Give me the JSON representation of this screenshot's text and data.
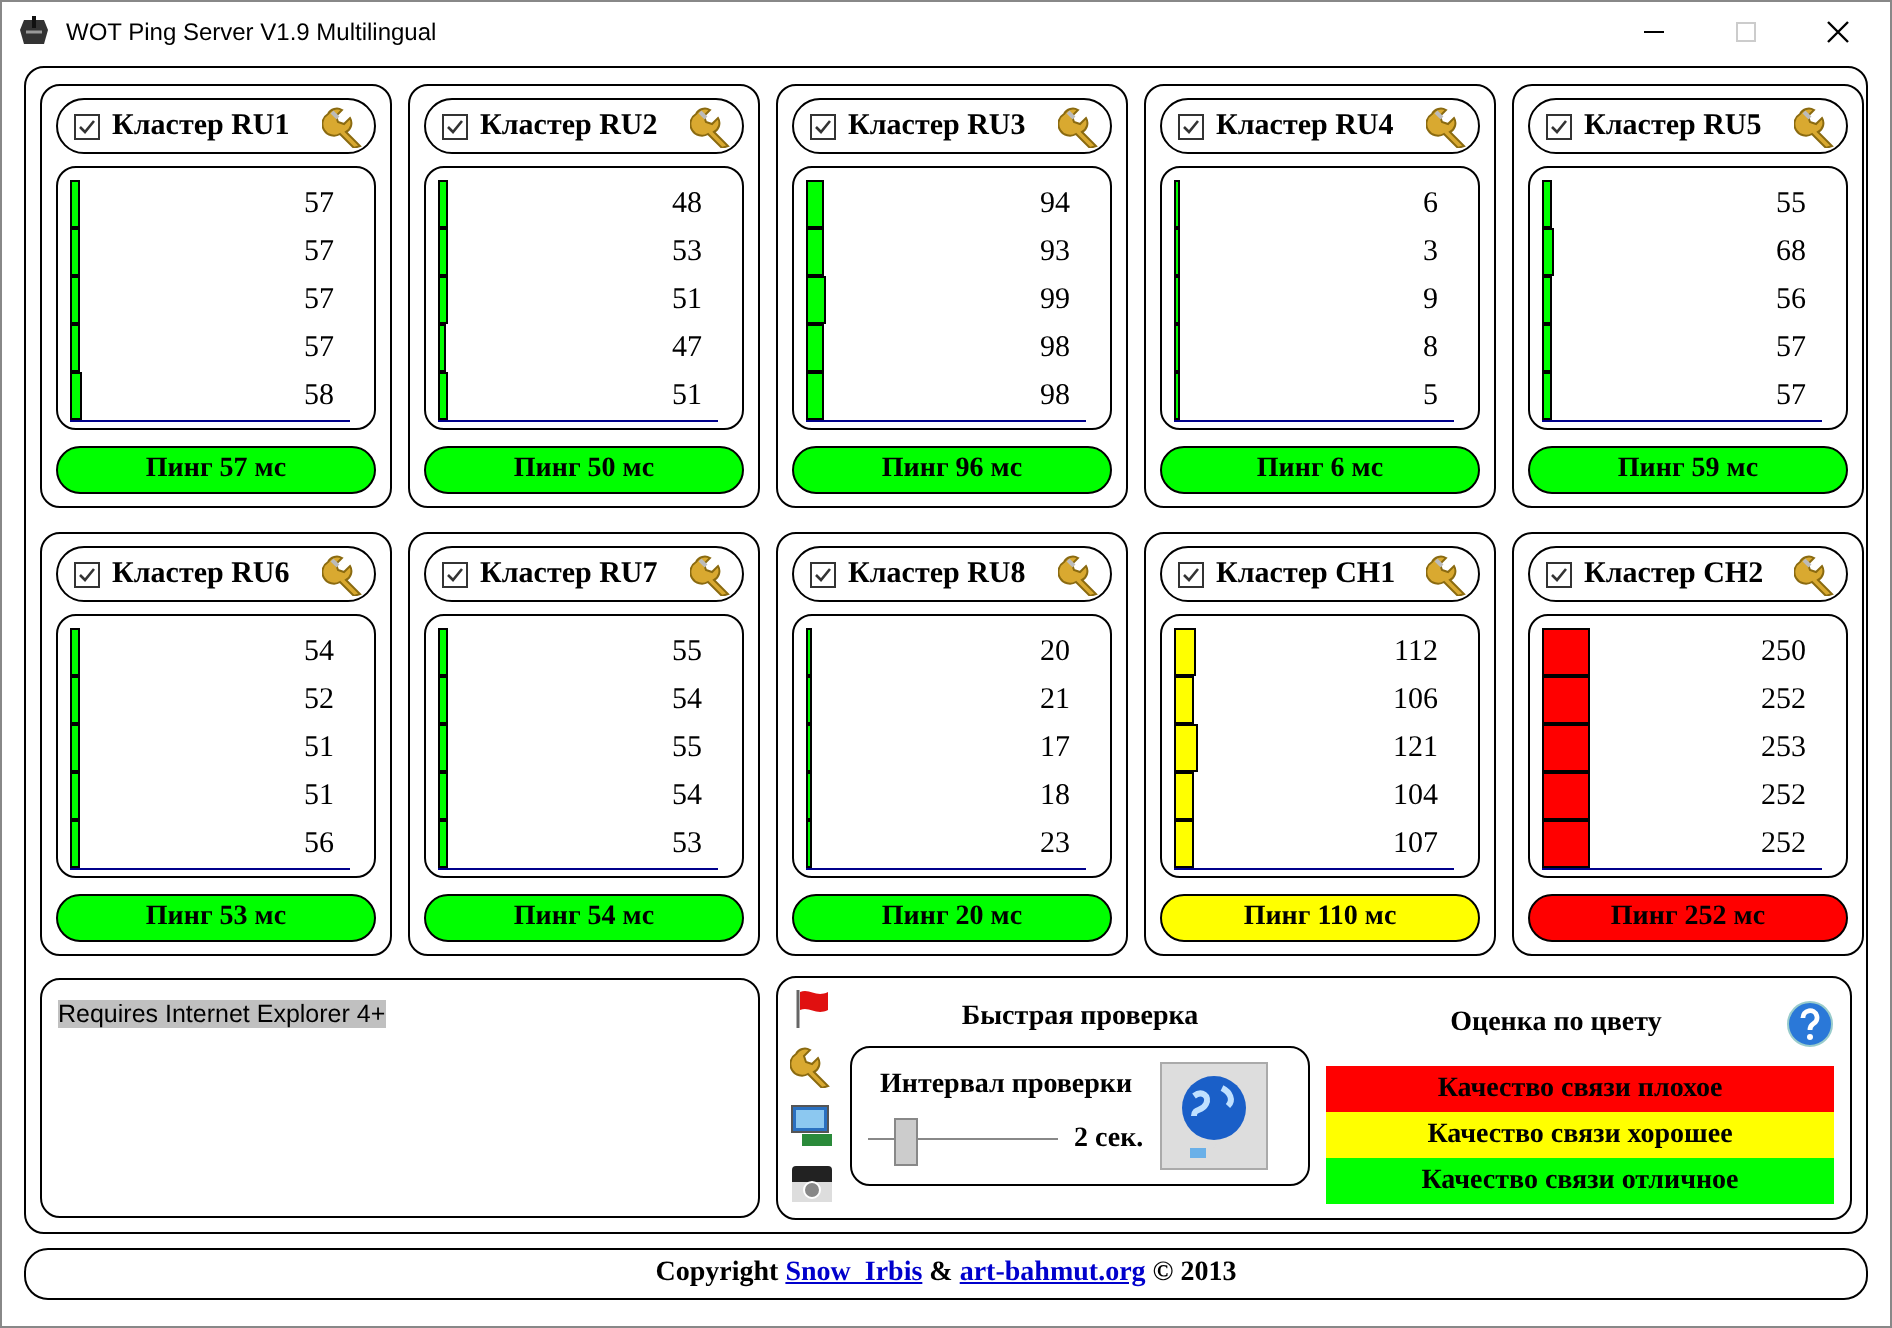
{
  "window": {
    "title": "WOT Ping Server V1.9 Multilingual"
  },
  "clusters": [
    {
      "title": "Кластер RU1",
      "checked": true,
      "color": "#00ff00",
      "ping_label": "Пинг 57 мс",
      "pings": [
        {
          "value": "57",
          "level": 0.038
        },
        {
          "value": "57",
          "level": 0.038
        },
        {
          "value": "57",
          "level": 0.038
        },
        {
          "value": "57",
          "level": 0.038
        },
        {
          "value": "58",
          "level": 0.039
        }
      ]
    },
    {
      "title": "Кластер RU2",
      "checked": true,
      "color": "#00ff00",
      "ping_label": "Пинг 50 мс",
      "pings": [
        {
          "value": "48",
          "level": 0.032
        },
        {
          "value": "53",
          "level": 0.035
        },
        {
          "value": "51",
          "level": 0.034
        },
        {
          "value": "47",
          "level": 0.031
        },
        {
          "value": "51",
          "level": 0.034
        }
      ]
    },
    {
      "title": "Кластер RU3",
      "checked": true,
      "color": "#00ff00",
      "ping_label": "Пинг 96 мс",
      "pings": [
        {
          "value": "94",
          "level": 0.063
        },
        {
          "value": "93",
          "level": 0.062
        },
        {
          "value": "99",
          "level": 0.066
        },
        {
          "value": "98",
          "level": 0.065
        },
        {
          "value": "98",
          "level": 0.065
        }
      ]
    },
    {
      "title": "Кластер RU4",
      "checked": true,
      "color": "#00ff00",
      "ping_label": "Пинг 6 мс",
      "pings": [
        {
          "value": "6",
          "level": 0.004
        },
        {
          "value": "3",
          "level": 0.002
        },
        {
          "value": "9",
          "level": 0.006
        },
        {
          "value": "8",
          "level": 0.005
        },
        {
          "value": "5",
          "level": 0.003
        }
      ]
    },
    {
      "title": "Кластер RU5",
      "checked": true,
      "color": "#00ff00",
      "ping_label": "Пинг 59 мс",
      "pings": [
        {
          "value": "55",
          "level": 0.037
        },
        {
          "value": "68",
          "level": 0.045
        },
        {
          "value": "56",
          "level": 0.037
        },
        {
          "value": "57",
          "level": 0.038
        },
        {
          "value": "57",
          "level": 0.038
        }
      ]
    },
    {
      "title": "Кластер RU6",
      "checked": true,
      "color": "#00ff00",
      "ping_label": "Пинг 53 мс",
      "pings": [
        {
          "value": "54",
          "level": 0.036
        },
        {
          "value": "52",
          "level": 0.035
        },
        {
          "value": "51",
          "level": 0.034
        },
        {
          "value": "51",
          "level": 0.034
        },
        {
          "value": "56",
          "level": 0.037
        }
      ]
    },
    {
      "title": "Кластер RU7",
      "checked": true,
      "color": "#00ff00",
      "ping_label": "Пинг 54 мс",
      "pings": [
        {
          "value": "55",
          "level": 0.037
        },
        {
          "value": "54",
          "level": 0.036
        },
        {
          "value": "55",
          "level": 0.037
        },
        {
          "value": "54",
          "level": 0.036
        },
        {
          "value": "53",
          "level": 0.035
        }
      ]
    },
    {
      "title": "Кластер RU8",
      "checked": true,
      "color": "#00ff00",
      "ping_label": "Пинг 20 мс",
      "pings": [
        {
          "value": "20",
          "level": 0.013
        },
        {
          "value": "21",
          "level": 0.014
        },
        {
          "value": "17",
          "level": 0.011
        },
        {
          "value": "18",
          "level": 0.012
        },
        {
          "value": "23",
          "level": 0.015
        }
      ]
    },
    {
      "title": "Кластер CH1",
      "checked": true,
      "color": "#ffff00",
      "ping_label": "Пинг 110 мс",
      "pings": [
        {
          "value": "112",
          "level": 0.075
        },
        {
          "value": "106",
          "level": 0.071
        },
        {
          "value": "121",
          "level": 0.081
        },
        {
          "value": "104",
          "level": 0.069
        },
        {
          "value": "107",
          "level": 0.071
        }
      ]
    },
    {
      "title": "Кластер CH2",
      "checked": true,
      "color": "#ff0000",
      "ping_label": "Пинг 252 мс",
      "pings": [
        {
          "value": "250",
          "level": 0.167
        },
        {
          "value": "252",
          "level": 0.168
        },
        {
          "value": "253",
          "level": 0.169
        },
        {
          "value": "252",
          "level": 0.168
        },
        {
          "value": "252",
          "level": 0.168
        }
      ]
    }
  ],
  "message": "Requires Internet Explorer 4+",
  "quick_check": {
    "title": "Быстрая проверка",
    "interval_label": "Интервал проверки",
    "interval": {
      "level": 0.2
    },
    "interval_value": "2 сек."
  },
  "color_legend": {
    "title": "Оценка по цвету",
    "items": [
      {
        "label": "Качество связи плохое",
        "color": "#ff0000"
      },
      {
        "label": "Качество связи хорошее",
        "color": "#ffff00"
      },
      {
        "label": "Качество связи отличное",
        "color": "#00ff00"
      }
    ]
  },
  "footer": {
    "prefix": "Copyright",
    "link_1": "Snow  Irbis",
    "separator": "&",
    "link_2": "art-bahmut.org",
    "suffix": "© 2013"
  }
}
